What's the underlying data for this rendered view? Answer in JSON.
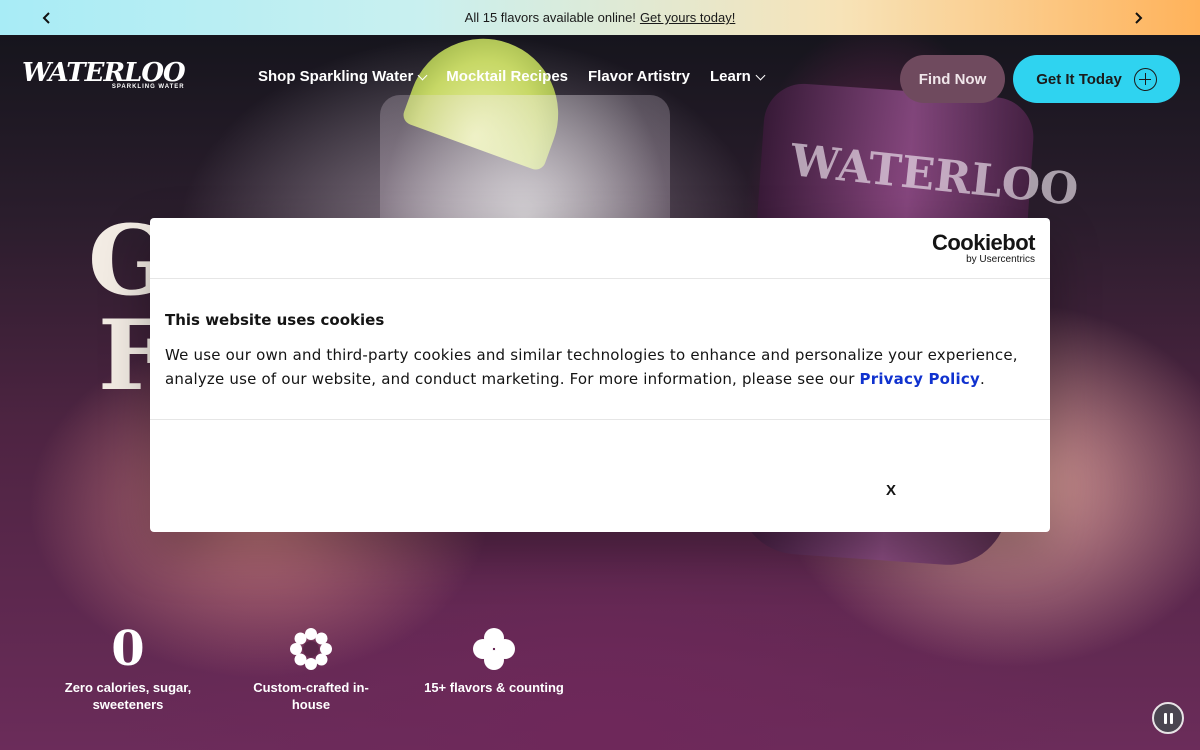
{
  "announcement": {
    "text": "All 15 flavors available online!",
    "link": "Get yours today!"
  },
  "brand": {
    "name": "WATERLOO",
    "tagline": "SPARKLING WATER"
  },
  "nav": {
    "items": [
      {
        "label": "Shop Sparkling Water",
        "dropdown": true
      },
      {
        "label": "Mocktail Recipes",
        "dropdown": false
      },
      {
        "label": "Flavor Artistry",
        "dropdown": false
      },
      {
        "label": "Learn",
        "dropdown": true
      }
    ],
    "find_now": "Find Now",
    "get_it_today": "Get It Today"
  },
  "hero": {
    "can_text": "WATERLOO",
    "heading_visible_start_line1": "G",
    "heading_visible_start_line2": "F"
  },
  "stats": [
    {
      "icon": "zero-icon",
      "value": "0",
      "label": "Zero calories, sugar, sweeteners"
    },
    {
      "icon": "gear-flower-icon",
      "label": "Custom-crafted in-house"
    },
    {
      "icon": "clover-icon",
      "label": "15+ flavors & counting"
    }
  ],
  "cookie_banner": {
    "brand": "Cookiebot",
    "brand_sub": "by Usercentrics",
    "title": "This website uses cookies",
    "text": "We use our own and third-party cookies and similar technologies to enhance and personalize your experience, analyze use of our website, and conduct marketing. For more information, please see our",
    "link": "Privacy Policy",
    "link_suffix": ".",
    "close": "X"
  },
  "colors": {
    "accent_cyan": "#2fd3f0",
    "find_now_bg": "#6f4a5e",
    "privacy_link": "#1032cf"
  }
}
